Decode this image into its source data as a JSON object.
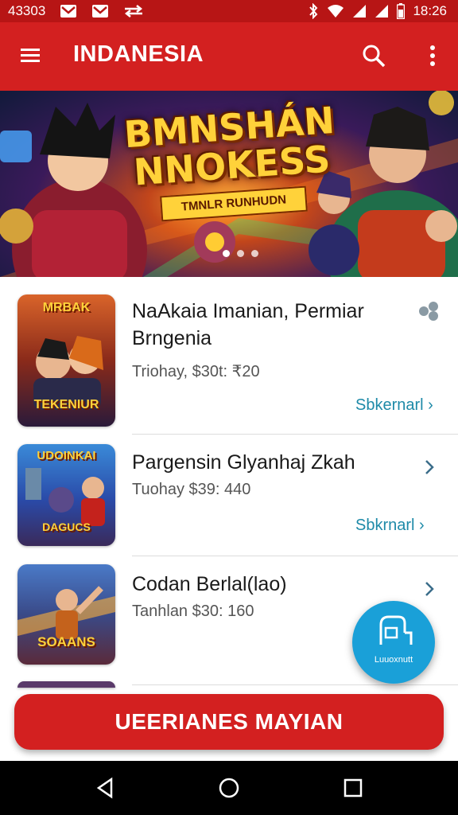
{
  "status_bar": {
    "left_text": "43303",
    "time": "18:26",
    "icons": [
      "mail-icon",
      "mail-icon",
      "transfer-arrows-icon",
      "bluetooth-icon",
      "wifi-icon",
      "signal-icon",
      "signal-icon",
      "battery-icon"
    ]
  },
  "app_bar": {
    "title": "INDANESIA",
    "icons": [
      "menu-icon",
      "search-icon",
      "more-vert-icon"
    ]
  },
  "banner": {
    "title_line1": "BMNSHÁN",
    "title_line2": "NNOKESS",
    "subtitle": "TMNLR RUNHUDN",
    "dot_count": 3,
    "active_dot": 1
  },
  "list": [
    {
      "title_line1": "NaAkaia Imanian, Permiar",
      "title_line2": "Brngenia",
      "meta": "Triohay, $30t: ₹20",
      "link": "Sbkernarl ›",
      "thumb_top": "MRBAK",
      "thumb_bottom": "TEKENIUR",
      "icon": "share-icon"
    },
    {
      "title_line1": "Pargensin Glyanhaj Zkah",
      "meta": "Tuohay $39: 440",
      "link": "Sbkrnarl ›",
      "thumb_top": "UDOINKAI",
      "thumb_bottom": "DAGUCS",
      "icon": "chevron-right-icon"
    },
    {
      "title_line1": "Codan Berlal(lao)",
      "meta": "Tanhlan $30: 160",
      "thumb_bottom": "SOAANS",
      "icon": "chevron-right-icon"
    }
  ],
  "fab": {
    "label": "Luuoxnutt"
  },
  "cta": {
    "label": "UEERIANES MAYIAN"
  },
  "colors": {
    "primary_red": "#d32020",
    "accent_blue": "#1aa0d8",
    "link_teal": "#1e8aa8"
  }
}
